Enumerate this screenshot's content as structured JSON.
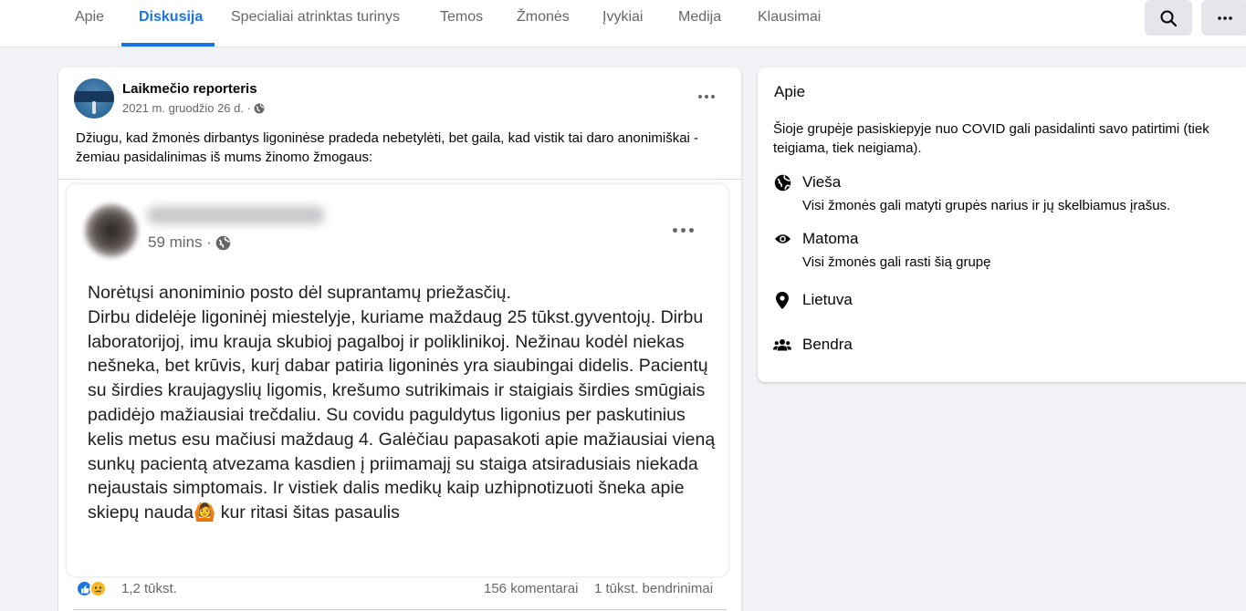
{
  "nav": {
    "tabs": [
      {
        "label": "Apie"
      },
      {
        "label": "Diskusija"
      },
      {
        "label": "Specialiai atrinktas turinys"
      },
      {
        "label": "Temos"
      },
      {
        "label": "Žmonės"
      },
      {
        "label": "Įvykiai"
      },
      {
        "label": "Medija"
      },
      {
        "label": "Klausimai"
      }
    ],
    "active_tab": "Diskusija",
    "search_icon": "search-icon",
    "more_icon": "more-horizontal-icon"
  },
  "post": {
    "author": "Laikmečio reporteris",
    "date": "2021 m. gruodžio 26 d. ·",
    "privacy_icon": "globe-icon",
    "text": "Džiugu, kad žmonės dirbantys ligoninėse pradeda nebetylėti, bet gaila, kad vistik tai daro anonimiškai - žemiau pasidalinimas iš mums žinomo žmogaus:",
    "shared_screenshot": {
      "time": "59 mins ·",
      "text": "Norėtųsi anoniminio posto dėl suprantamų priežasčių.\nDirbu didelėje ligoninėj miestelyje, kuriame maždaug 25 tūkst.gyventojų. Dirbu laboratorijoj, imu krauja skubioj pagalboj ir poliklinikoj. Nežinau kodėl niekas nešneka, bet krūvis, kurį dabar patiria ligoninės yra siaubingai didelis. Pacientų su širdies kraujagyslių ligomis, krešumo sutrikimais ir staigiais širdies smūgiais padidėjo mažiausiai trečdaliu. Su covidu paguldytus ligonius per paskutinius kelis metus esu mačiusi maždaug 4. Galėčiau papasakoti apie mažiausiai vieną sunkų pacientą atvezama kasdien į priimamajį su staiga atsiradusiais niekada nejaustais simptomais. Ir vistiek dalis medikų kaip uzhipnotizuoti šneka apie skiepų nauda",
      "text_emoji": "🙆",
      "text_end": " kur ritasi šitas pasaulis"
    },
    "reaction_count": "1,2 tūkst.",
    "comments": "156 komentarai",
    "shares": "1 tūkst. bendrinimai"
  },
  "about": {
    "title": "Apie",
    "description": "Šioje grupėje pasiskiepyje nuo COVID gali pasidalinti savo patirtimi (tiek teigiama, tiek neigiama).",
    "items": [
      {
        "icon": "globe-icon",
        "title": "Vieša",
        "desc": "Visi žmonės gali matyti grupės narius ir jų skelbiamus įrašus."
      },
      {
        "icon": "eye-icon",
        "title": "Matoma",
        "desc": "Visi žmonės gali rasti šią grupę"
      },
      {
        "icon": "location-pin-icon",
        "title": "Lietuva",
        "desc": ""
      },
      {
        "icon": "people-icon",
        "title": "Bendra",
        "desc": ""
      }
    ]
  },
  "colors": {
    "accent": "#1b74e4",
    "background": "#f0f2f5",
    "secondary_text": "#65676b"
  }
}
